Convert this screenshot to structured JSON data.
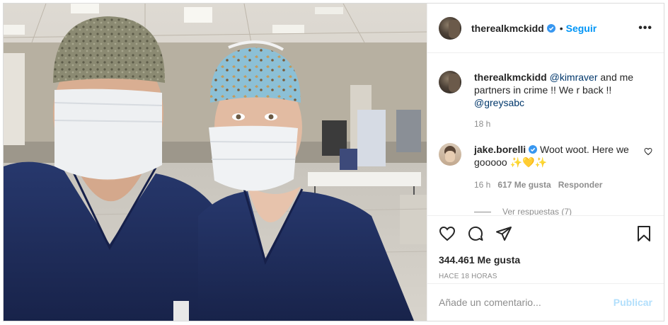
{
  "post": {
    "username": "therealkmckidd",
    "follow_label": "Seguir",
    "dot": "•",
    "more_label": "•••"
  },
  "caption": {
    "username": "therealkmckidd",
    "mention": "@kimraver",
    "text_1": " and me partners in crime !! We r back !! ",
    "tag": "@greysabc",
    "time": "18 h"
  },
  "comment": {
    "username": "jake.borelli",
    "text": " Woot woot. Here we gooooo ",
    "emojis": "✨💛✨",
    "time": "16 h",
    "likes": "617 Me gusta",
    "reply_label": "Responder",
    "view_replies": "Ver respuestas (7)"
  },
  "stats": {
    "likes": "344.461 Me gusta",
    "time": "HACE 18 HORAS"
  },
  "composer": {
    "placeholder": "Añade un comentario...",
    "publish_label": "Publicar"
  },
  "colors": {
    "accent": "#0095f6",
    "verified": "#3897f0",
    "scrubs": "#1f2d5c"
  },
  "icons": [
    "verified-icon",
    "more-icon",
    "like-heart-icon",
    "comment-icon",
    "share-icon",
    "save-icon",
    "comment-heart-icon"
  ]
}
